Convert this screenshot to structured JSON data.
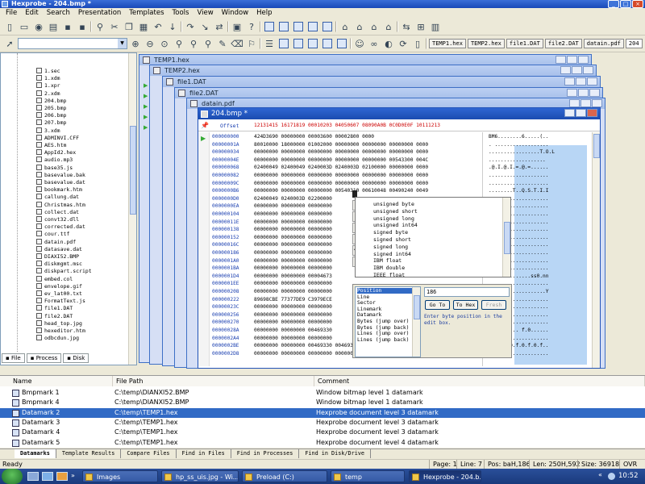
{
  "window": {
    "title": "Hexprobe - 204.bmp *"
  },
  "menu": [
    "File",
    "Edit",
    "Search",
    "Presentation",
    "Templates",
    "Tools",
    "View",
    "Window",
    "Help"
  ],
  "doc_tabs": [
    "TEMP1.hex",
    "TEMP2.hex",
    "file1.DAT",
    "file2.DAT",
    "datain.pdf",
    "204"
  ],
  "file_tree": [
    "1.sec",
    "1.xdm",
    "1.xpr",
    "2.xdm",
    "204.bmp",
    "205.bmp",
    "206.bmp",
    "207.bmp",
    "3.xdm",
    "ADMINVI.CFF",
    "AES.htm",
    "AppId2.hex",
    "audio.mp3",
    "base35.js",
    "basevalue.bak",
    "basevalue.dat",
    "bookmark.htm",
    "callung.dat",
    "Christmas.htm",
    "collect.dat",
    "convt32.dll",
    "corrected.dat",
    "cour.ttf",
    "datain.pdf",
    "datasave.dat",
    "DIAXI52.BMP",
    "diskmgmt.msc",
    "diskpart.script",
    "embed.col",
    "envelope.gif",
    "ev_lat00.txt",
    "FormatText.js",
    "file1.DAT",
    "file2.DAT",
    "head_top.jpg",
    "hexeditor.htm",
    "odbcdun.jpg"
  ],
  "left_tabs": [
    "File",
    "Process",
    "Disk"
  ],
  "mdi_windows": [
    "TEMP1.hex",
    "TEMP2.hex",
    "file1.DAT",
    "file2.DAT",
    "datain.pdf"
  ],
  "hexwin": {
    "title": "204.bmp *",
    "header_offset": "Offset",
    "header_cols": "12131415 16171819 00010203 04050607 08090A0B 0C0D0E0F 10111213",
    "rows": [
      {
        "ofs": "000000000",
        "hex": "                                   424D3690 00000000 00003600 00002800 0000",
        "ascii": "BM6........6.....(.."
      },
      {
        "ofs": "00000001A",
        "hex": "80010000 18000000 01002000 00000000 00000000 00000000 0000",
        "ascii": ". .................."
      },
      {
        "ofs": "000000034",
        "hex": "00000000 00000000 00000000 00000000 00000000 00000000 0000",
        "ascii": ".................T.O.L"
      },
      {
        "ofs": "00000004E",
        "hex": "00000000 00000000 00000000 00000000 00000000 00543300 004C",
        "ascii": "..................."
      },
      {
        "ofs": "000000068",
        "hex": "02400049 02400049 0240003D 0240003D 02100000 00000000 0000",
        "ascii": ".@.I.@.I.=.@.=......"
      },
      {
        "ofs": "000000082",
        "hex": "00000000 00000000 00000000 00000000 00000000 00000000 0000",
        "ascii": "...................."
      },
      {
        "ofs": "00000009C",
        "hex": "00000000 00000000 00000000 00000000 00000000 00000000 0000",
        "ascii": "...................."
      },
      {
        "ofs": "0000000B6",
        "hex": "00000000 00000000 00000000 00540310 00610048 00490240 0049",
        "ascii": "........T..Q.S.T.I.I"
      },
      {
        "ofs": "0000000D0",
        "hex": "02400049 0240003D 02200000",
        "ascii": "...................."
      },
      {
        "ofs": "0000000EA",
        "hex": "00000000 00000000 00000000",
        "ascii": "...................."
      },
      {
        "ofs": "000000104",
        "hex": "00000000 00000000 00000000",
        "ascii": "...................."
      },
      {
        "ofs": "00000011E",
        "hex": "00000000 00000000 00000000",
        "ascii": "...................."
      },
      {
        "ofs": "000000138",
        "hex": "00000000 00000000 00000000",
        "ascii": "...................."
      },
      {
        "ofs": "000000152",
        "hex": "00000000 00000000 00000000",
        "ascii": "...................."
      },
      {
        "ofs": "00000016C",
        "hex": "00000000 00000000 00000000",
        "ascii": "...................."
      },
      {
        "ofs": "000000186",
        "hex": "00000000 00000000 00000000",
        "ascii": "...................."
      },
      {
        "ofs": "0000001A0",
        "hex": "00000000 00000000 00000000",
        "ascii": "...................."
      },
      {
        "ofs": "0000001BA",
        "hex": "00000000 00000000 00000000",
        "ascii": "...................."
      },
      {
        "ofs": "0000001D4",
        "hex": "00000000 00000000 00004673",
        "ascii": "..............ss0.nn"
      },
      {
        "ofs": "0000001EE",
        "hex": "00000000 00000000 00000000",
        "ascii": "...................."
      },
      {
        "ofs": "000000208",
        "hex": "00000000 00000000 00000000",
        "ascii": "...................Y"
      },
      {
        "ofs": "000000222",
        "hex": "89698CBE 77377DE9 C3979ECE",
        "ascii": "...................."
      },
      {
        "ofs": "00000023C",
        "hex": "00000000 00000000 00000000",
        "ascii": "...................."
      },
      {
        "ofs": "000000256",
        "hex": "00000000 00000000 00000000",
        "ascii": "...................."
      },
      {
        "ofs": "000000270",
        "hex": "00000000 00000000 00000000",
        "ascii": "...................."
      },
      {
        "ofs": "00000028A",
        "hex": "00000000 00000000 00469330",
        "ascii": ".......... f.0......"
      },
      {
        "ofs": "0000002A4",
        "hex": "00000000 00000000 00000000",
        "ascii": "...................."
      },
      {
        "ofs": "0000002BE",
        "hex": "00000000 00000000 00469330 00469330 00469330 00469330 0046",
        "ascii": ".f.0.f.0.f.0.f.0.f.."
      },
      {
        "ofs": "0000002D8",
        "hex": "00000000 00000000 00000000 00000000 00000000 00000000 0000",
        "ascii": "...................."
      }
    ]
  },
  "type_list": [
    "unsigned byte",
    "unsigned short",
    "unsigned long",
    "unsigned int64",
    "signed byte",
    "signed short",
    "signed long",
    "signed int64",
    "IBM float",
    "IBM double",
    "IEEE float"
  ],
  "goto": {
    "modes": [
      "Position",
      "Line",
      "Sector",
      "Linemark",
      "Datamark",
      "Bytes (jump over)",
      "Bytes (jump back)",
      "Lines (jump over)",
      "Lines (jump back)"
    ],
    "value": "186",
    "go_to": "Go To",
    "to_hex": "To Hex",
    "fresh": "Fresh",
    "hint": "Enter byte position in the edit box."
  },
  "bottom": {
    "columns": [
      "Name",
      "File Path",
      "Comment"
    ],
    "rows": [
      {
        "name": "Bmpmark 1",
        "path": "C:\\temp\\DIANXI52.BMP",
        "comment": "Window bitmap level 1 datamark"
      },
      {
        "name": "Bmpmark 4",
        "path": "C:\\temp\\DIANXI52.BMP",
        "comment": "Window bitmap level 1 datamark"
      },
      {
        "name": "Datamark 2",
        "path": "C:\\temp\\TEMP1.hex",
        "comment": "Hexprobe document level 3 datamark"
      },
      {
        "name": "Datamark 3",
        "path": "C:\\temp\\TEMP1.hex",
        "comment": "Hexprobe document level 3 datamark"
      },
      {
        "name": "Datamark 4",
        "path": "C:\\temp\\TEMP1.hex",
        "comment": "Hexprobe document level 3 datamark"
      },
      {
        "name": "Datamark 5",
        "path": "C:\\temp\\TEMP1.hex",
        "comment": "Hexprobe document level 4 datamark"
      }
    ],
    "tabs": [
      "Datamarks",
      "Template Results",
      "Compare Files",
      "Find in Files",
      "Find in Processes",
      "Find in Disk/Drive"
    ]
  },
  "status": {
    "ready": "Ready",
    "page": "Page: 1",
    "line": "Line: 7",
    "pos": "Pos: baH,186",
    "len": "Len: 250H,592",
    "size": "Size: 36918",
    "mode": "OVR"
  },
  "taskbar": {
    "tasks": [
      "Images",
      "hp_ss_uis.jpg - Wi...",
      "Preload (C:)",
      "temp",
      "Hexprobe - 204.b..."
    ],
    "clock": "10:52"
  },
  "colors": {
    "selection": "#316ac5",
    "title": "#1848b8",
    "offset_blue": "#1a3fb0",
    "ascii_highlight": "#b8d6f5"
  }
}
